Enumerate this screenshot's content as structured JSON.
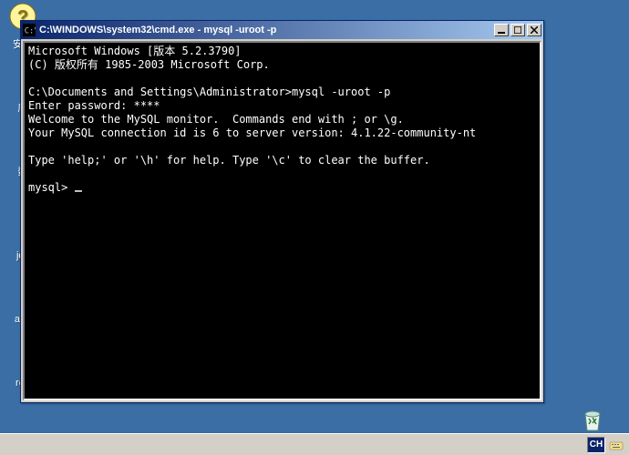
{
  "desktop": {
    "icons": {
      "anquan": "安全",
      "xulie": "序",
      "shu": "数",
      "jdk": "jdk",
      "apa": "apa",
      "red": "red",
      "recycle": "回收站"
    }
  },
  "window": {
    "title": "C:\\WINDOWS\\system32\\cmd.exe - mysql -uroot -p"
  },
  "console": {
    "line1": "Microsoft Windows [版本 5.2.3790]",
    "line2": "(C) 版权所有 1985-2003 Microsoft Corp.",
    "blank1": "",
    "line3": "C:\\Documents and Settings\\Administrator>mysql -uroot -p",
    "line4": "Enter password: ****",
    "line5": "Welcome to the MySQL monitor.  Commands end with ; or \\g.",
    "line6": "Your MySQL connection id is 6 to server version: 4.1.22-community-nt",
    "blank2": "",
    "line7": "Type 'help;' or '\\h' for help. Type '\\c' to clear the buffer.",
    "blank3": "",
    "prompt": "mysql> "
  },
  "taskbar": {
    "lang": "CH"
  }
}
